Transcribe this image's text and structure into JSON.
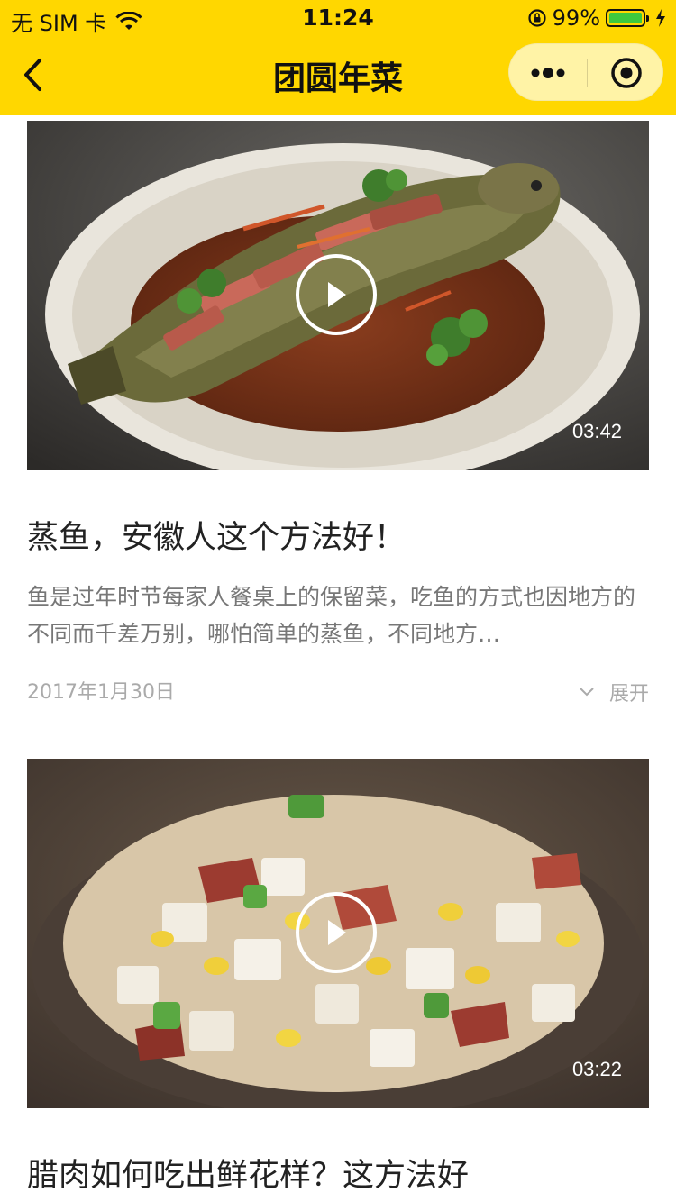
{
  "status_bar": {
    "carrier": "无 SIM 卡",
    "time": "11:24",
    "battery_percent": "99%",
    "battery_level": 0.99,
    "icons": [
      "wifi-icon",
      "rotation-lock-icon",
      "battery-icon",
      "charging-icon"
    ]
  },
  "nav": {
    "title": "团圆年菜",
    "background": "#FFD700",
    "icons": [
      "back-chevron-icon",
      "more-dots-icon",
      "close-target-icon"
    ]
  },
  "articles": [
    {
      "duration": "03:42",
      "title": "蒸鱼，安徽人这个方法好！",
      "description": "鱼是过年时节每家人餐桌上的保留菜，吃鱼的方式也因地方的不同而千差万别，哪怕简单的蒸鱼，不同地方…",
      "date": "2017年1月30日",
      "expand_label": "展开"
    },
    {
      "duration": "03:22",
      "title": "腊肉如何吃出鲜花样？这方法好"
    }
  ]
}
